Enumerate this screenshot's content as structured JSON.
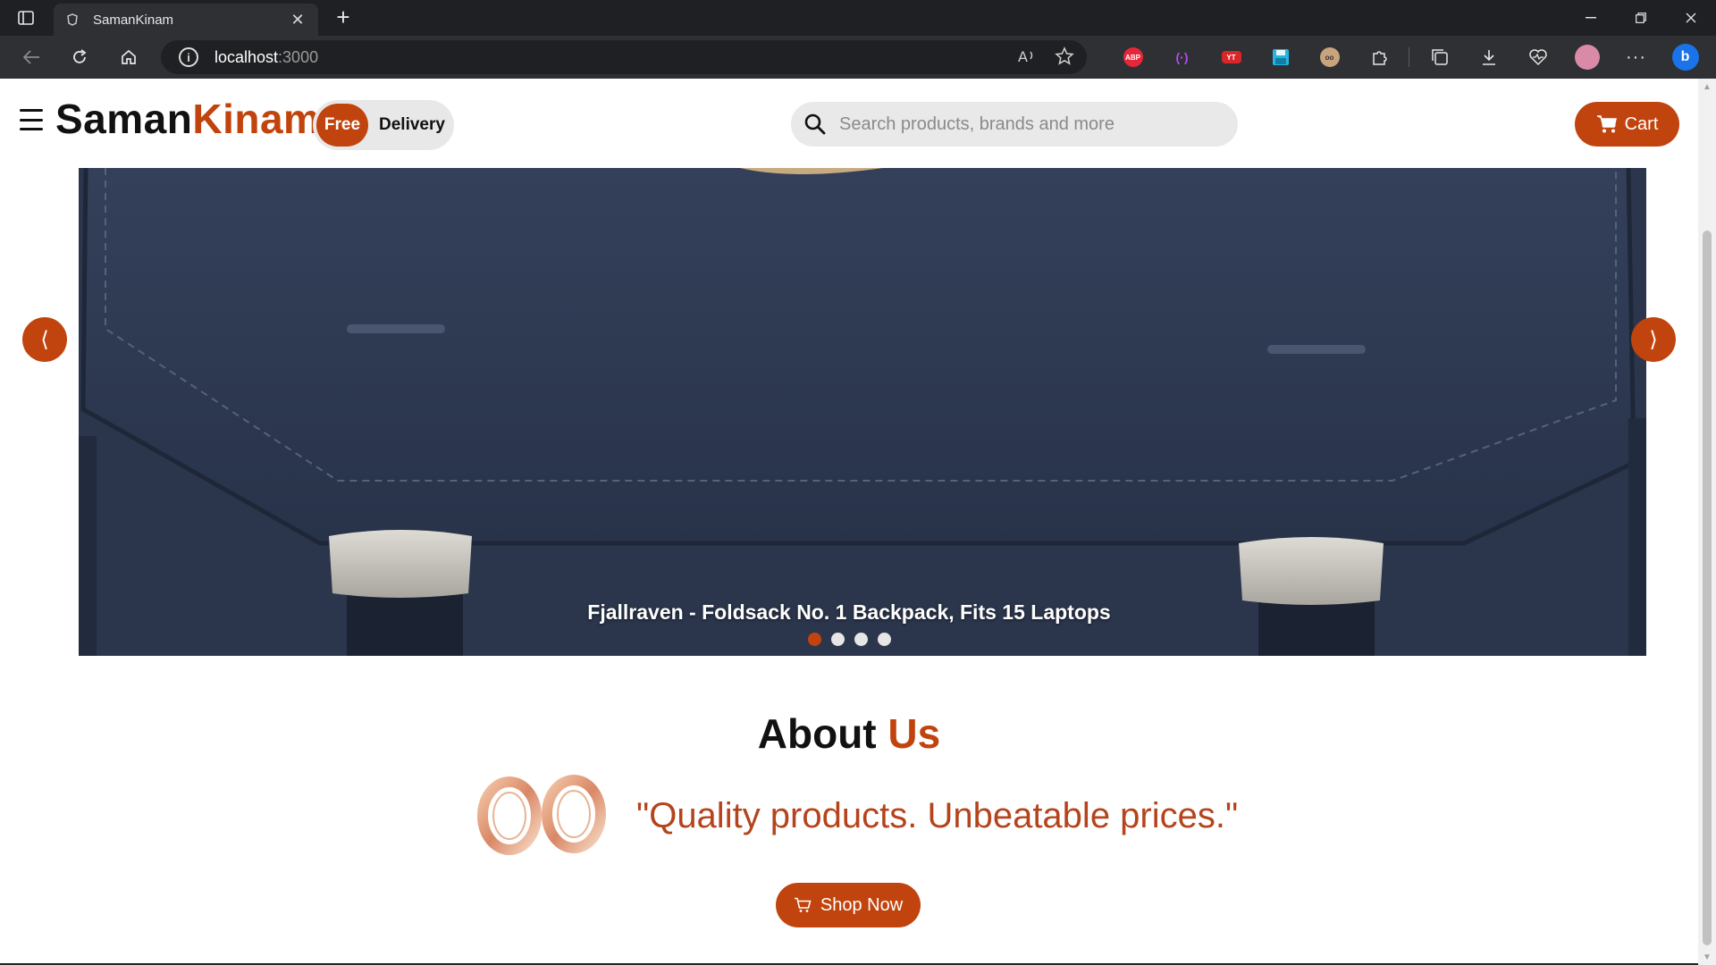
{
  "browser": {
    "tab_title": "SamanKinam",
    "url_host": "localhost",
    "url_port": ":3000",
    "extensions": [
      "abp-icon",
      "extension-purple-icon",
      "extension-red-icon",
      "save-icon",
      "glasses-icon",
      "puzzle-icon",
      "collections-icon",
      "download-icon",
      "heartbeat-icon",
      "profile-avatar",
      "more-icon",
      "copilot-icon"
    ]
  },
  "navbar": {
    "logo_main": "Saman",
    "logo_accent": "Kinam",
    "free_label": "Free",
    "delivery_label": "Delivery",
    "search_placeholder": "Search products, brands and more",
    "cart_label": "Cart"
  },
  "carousel": {
    "caption": "Fjallraven - Foldsack No. 1 Backpack, Fits 15 Laptops",
    "prev_symbol": "⟨",
    "next_symbol": "⟩",
    "slide_count": 4,
    "active_index": 0
  },
  "about": {
    "title_main": "About",
    "title_accent": "Us",
    "quote": "\"Quality products. Unbeatable prices.\"",
    "shop_button": "Shop Now"
  },
  "colors": {
    "accent": "#c1440e",
    "quote": "#b5441c",
    "backpack": "#2e3a52"
  }
}
